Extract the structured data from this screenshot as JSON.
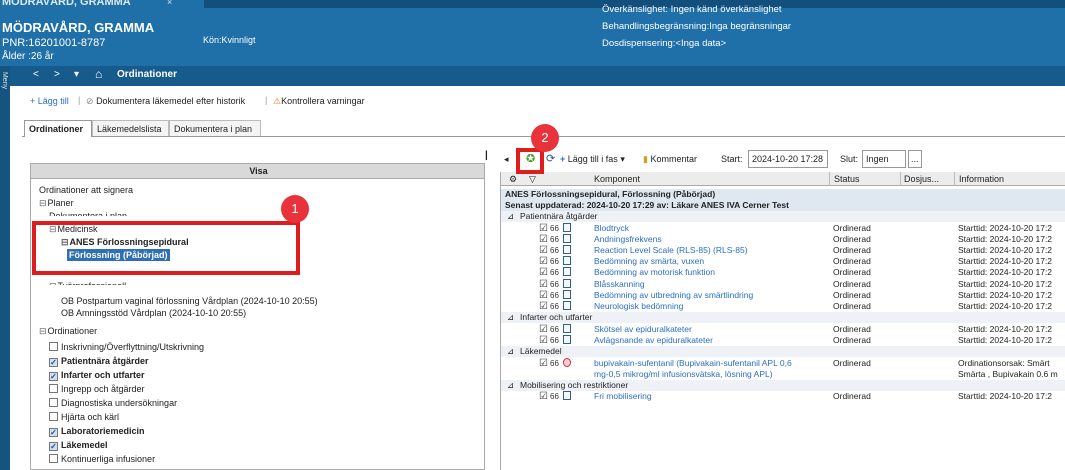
{
  "banner": {
    "top_title": "MÖDRAVÅRD, GRAMMA",
    "close": "×",
    "patient_name": "MÖDRAVÅRD, GRAMMA",
    "pnr": "PNR:16201001-8787",
    "age": "Ålder :26 år",
    "kon": "Kön:Kvinnligt",
    "allergy": "Överkänslighet: Ingen känd överkänslighet",
    "treatment": "Behandlingsbegränsning:Inga begränsningar",
    "dose": "Dosdispensering:<Inga data>"
  },
  "nav": {
    "back": "<",
    "forward": ">",
    "dropdown": "▾",
    "home": "⌂",
    "title": "Ordinationer",
    "side": "Meny"
  },
  "toolbar": {
    "add": "+ Lägg till",
    "document_history": "Dokumentera läkemedel efter historik",
    "check_warnings": "Kontrollera varningar"
  },
  "tabs": [
    "Ordinationer",
    "Läkemedelslista",
    "Dokumentera i plan"
  ],
  "left_panel": {
    "header": "Visa",
    "tree": [
      {
        "text": "Ordinationer att signera",
        "indent": 0
      },
      {
        "text": "Planer",
        "indent": 0,
        "toggle": "⊟"
      },
      {
        "text": "Dokumentera i plan",
        "indent": 1
      },
      {
        "text": "Medicinsk",
        "indent": 1,
        "toggle": "⊟"
      },
      {
        "text": "ANES Förlossningsepidural",
        "indent": 2,
        "toggle": "⊟",
        "bold": true
      },
      {
        "text": "Förlossning (Påbörjad)",
        "indent": 3,
        "selected": true
      },
      {
        "text": "Tvärprofessionell",
        "indent": 1,
        "toggle": "⊟"
      },
      {
        "text": "OB Postpartum vaginal förlossning Vårdplan (2024-10-10 20:55)",
        "indent": 2
      },
      {
        "text": "OB Amningsstöd Vårdplan (2024-10-10 20:55)",
        "indent": 2
      },
      {
        "text": "Ordinationer",
        "indent": 0,
        "toggle": "⊟"
      },
      {
        "text": "Inskrivning/Överflyttning/Utskrivning",
        "indent": 1,
        "cb": true,
        "on": false
      },
      {
        "text": "Patientnära åtgärder",
        "indent": 1,
        "cb": true,
        "on": true,
        "bold": true
      },
      {
        "text": "Infarter och utfarter",
        "indent": 1,
        "cb": true,
        "on": true,
        "bold": true
      },
      {
        "text": "Ingrepp och åtgärder",
        "indent": 1,
        "cb": true,
        "on": false
      },
      {
        "text": "Diagnostiska undersökningar",
        "indent": 1,
        "cb": true,
        "on": false
      },
      {
        "text": "Hjärta och kärl",
        "indent": 1,
        "cb": true,
        "on": false
      },
      {
        "text": "Laboratoriemedicin",
        "indent": 1,
        "cb": true,
        "on": true,
        "bold": true
      },
      {
        "text": "Läkemedel",
        "indent": 1,
        "cb": true,
        "on": true,
        "bold": true
      },
      {
        "text": "Kontinuerliga infusioner",
        "indent": 1,
        "cb": true,
        "on": false
      }
    ]
  },
  "right_toolbar": {
    "collapse": "◂",
    "add_phase": "Lägg till i fas",
    "comment": "Kommentar",
    "start_label": "Start:",
    "start_value": "2024-10-20 17:28",
    "end_label": "Slut:",
    "end_value": "Ingen",
    "more": "..."
  },
  "grid": {
    "columns": [
      "Komponent",
      "Status",
      "Dosjus...",
      "Information"
    ],
    "plan_title": "ANES Förlossningsepidural, Förlossning (Påbörjad)",
    "plan_updated": "Senast uppdaterad: 2024-10-20 17:29   av: Läkare ANES IVA Cerner Test",
    "sections": [
      {
        "title": "Patientnära åtgärder",
        "rows": [
          {
            "comp": "Blodtryck",
            "status": "Ordinerad",
            "info": "Starttid: 2024-10-20 17:2"
          },
          {
            "comp": "Andningsfrekvens",
            "status": "Ordinerad",
            "info": "Starttid: 2024-10-20 17:2"
          },
          {
            "comp": "Reaction Level Scale (RLS-85) (RLS-85)",
            "status": "Ordinerad",
            "info": "Starttid: 2024-10-20 17:2"
          },
          {
            "comp": "Bedömning av smärta, vuxen",
            "status": "Ordinerad",
            "info": "Starttid: 2024-10-20 17:2"
          },
          {
            "comp": "Bedömning av motorisk funktion",
            "status": "Ordinerad",
            "info": "Starttid: 2024-10-20 17:2"
          },
          {
            "comp": "Blåsskanning",
            "status": "Ordinerad",
            "info": "Starttid: 2024-10-20 17:2"
          },
          {
            "comp": "Bedömning av utbredning av smärtlindring",
            "status": "Ordinerad",
            "info": "Starttid: 2024-10-20 17:2"
          },
          {
            "comp": "Neurologisk bedömning",
            "status": "Ordinerad",
            "info": "Starttid: 2024-10-20 17:2"
          }
        ]
      },
      {
        "title": "Infarter och utfarter",
        "rows": [
          {
            "comp": "Skötsel av epiduralkateter",
            "status": "Ordinerad",
            "info": "Starttid: 2024-10-20 17:2"
          },
          {
            "comp": "Avlägsnande av epiduralkateter",
            "status": "Ordinerad",
            "info": "Starttid: 2024-10-20 17:2"
          }
        ]
      },
      {
        "title": "Läkemedel",
        "rows": [
          {
            "comp": "bupivakain-sufentanil (Bupivakain-sufentanil APL 0,6",
            "comp2": "mg-0,5 mikrog/ml infusionsvätska, lösning APL)",
            "status": "Ordinerad",
            "info": "Ordinationsorsak: Smärt",
            "info2": "Smärta , Bupivakain 0.6 m"
          }
        ]
      },
      {
        "title": "Mobilisering och restriktioner",
        "rows": [
          {
            "comp": "Fri mobilisering",
            "status": "Ordinerad",
            "info": "Starttid: 2024-10-20 17:2"
          }
        ]
      }
    ]
  },
  "callouts": [
    "1",
    "2"
  ],
  "colors": {
    "banner": "#1f6fa8",
    "accent_red": "#e01d1d",
    "link": "#2a6ec2",
    "selected": "#2f6fb7"
  }
}
